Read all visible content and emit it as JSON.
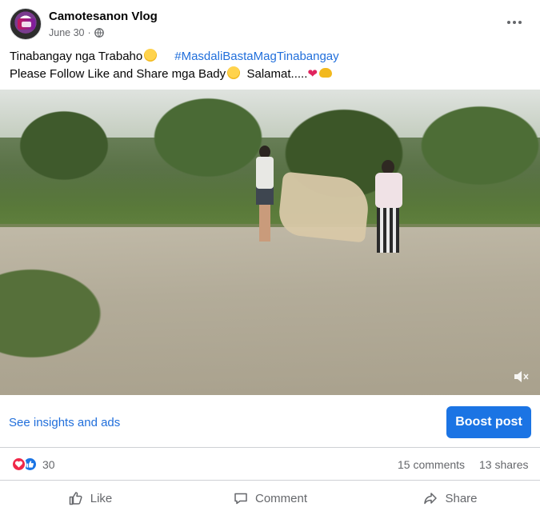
{
  "post": {
    "author": "Camotesanon Vlog",
    "date": "June 30",
    "separator": "·",
    "audience_icon": "globe-icon",
    "caption_line1": "Tinabangay nga Trabaho",
    "hashtag": "#MasdaliBastaMagTinabangay",
    "caption_line2": "Please Follow Like and Share mga Bady",
    "caption_line2b": "Salamat.....",
    "more_icon": "more-options-icon"
  },
  "insights": {
    "link_label": "See insights and ads",
    "boost_label": "Boost post"
  },
  "stats": {
    "reaction_count": "30",
    "comments": "15 comments",
    "shares": "13 shares"
  },
  "actions": {
    "like": "Like",
    "comment": "Comment",
    "share": "Share"
  },
  "colors": {
    "link": "#216fdb",
    "boost": "#1b74e4",
    "love": "#f02849",
    "muted_text": "#65676b"
  }
}
